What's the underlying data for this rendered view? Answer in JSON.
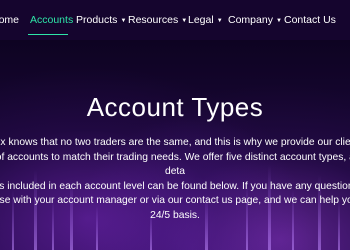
{
  "nav": {
    "items": [
      {
        "label": "Home",
        "has_dropdown": false,
        "active": false
      },
      {
        "label": "Accounts",
        "has_dropdown": false,
        "active": true
      },
      {
        "label": "Products",
        "has_dropdown": true,
        "active": false
      },
      {
        "label": "Resources",
        "has_dropdown": true,
        "active": false
      },
      {
        "label": "Legal",
        "has_dropdown": true,
        "active": false
      },
      {
        "label": "Company",
        "has_dropdown": true,
        "active": false
      },
      {
        "label": "Contact Us",
        "has_dropdown": false,
        "active": false
      }
    ],
    "active_color": "#2ee6a8"
  },
  "hero": {
    "title": "Account Types",
    "paragraph_lines": [
      "Finflow-x knows that no two traders are the same, and this is why we provide our clients with",
      "range of accounts to match their trading needs. We offer five distinct account types, and the deta",
      "of what is included in each account level can be found below. If you have any questions, pleas",
      "touch base with your account manager or via our contact us page, and we can help you out on",
      "24/5 basis."
    ]
  },
  "colors": {
    "nav_background": "#15052e",
    "hero_background": "#1a0838",
    "text": "#ffffff"
  }
}
